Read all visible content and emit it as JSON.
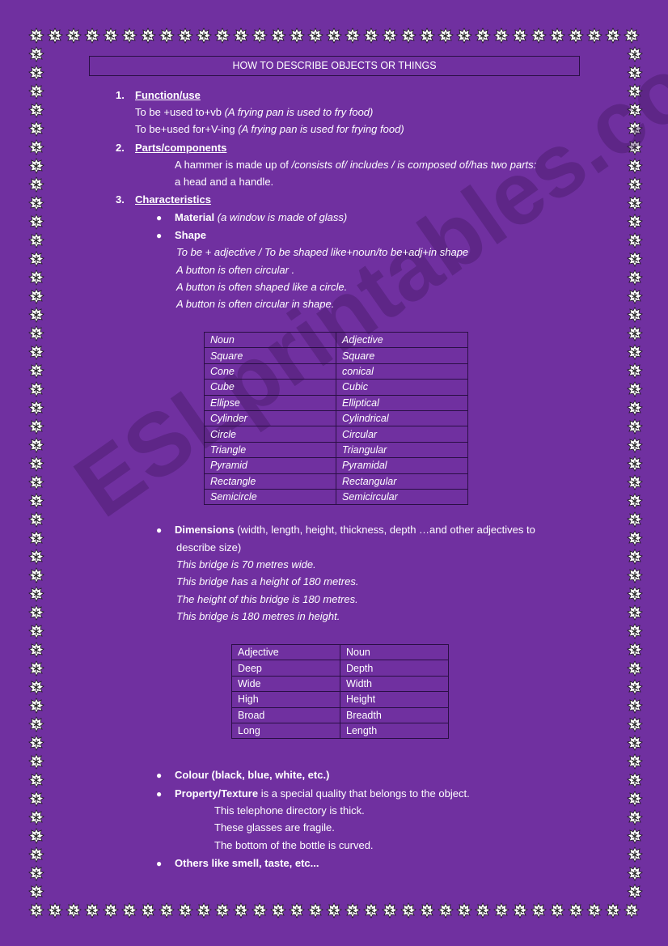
{
  "title": "HOW TO DESCRIBE OBJECTS OR THINGS",
  "colors": {
    "background": "#7030a0",
    "text": "#ffffff",
    "border_line": "#2a0f45"
  },
  "border_icon": "leaf-icon",
  "watermark": "ESLprintables.com",
  "sections": [
    {
      "number": "1.",
      "heading": "Function/use",
      "lines": [
        {
          "plain": "To be +used to+vb ",
          "italic": "(A frying pan  is used to fry food)"
        },
        {
          "plain": "To be+used for+V-ing ",
          "italic": "(A frying pan  is used for frying  food)"
        }
      ]
    },
    {
      "number": "2.",
      "heading": "Parts/components",
      "lines": [
        {
          "plain": "A hammer  is made up of ",
          "italic": "/consists of/ includes / is composed of/has two parts:"
        },
        {
          "plain": "a head and a handle.",
          "italic": ""
        }
      ]
    },
    {
      "number": "3.",
      "heading": "Characteristics",
      "material": {
        "label": "Material",
        "example": " (a window  is made of glass)"
      },
      "shape": {
        "label": "Shape",
        "lines": [
          "To be + adjective / To be shaped like+noun/to be+adj+in shape",
          "A button is often circular .",
          "A button  is often  shaped like a circle.",
          "A button  is often circular in shape."
        ],
        "table": {
          "headers": [
            "Noun",
            "Adjective"
          ],
          "rows": [
            [
              "Square",
              "Square"
            ],
            [
              "Cone",
              "conical"
            ],
            [
              "Cube",
              "Cubic"
            ],
            [
              "Ellipse",
              "Elliptical"
            ],
            [
              "Cylinder",
              "Cylindrical"
            ],
            [
              "Circle",
              "Circular"
            ],
            [
              "Triangle",
              "Triangular"
            ],
            [
              "Pyramid",
              "Pyramidal"
            ],
            [
              "Rectangle",
              "Rectangular"
            ],
            [
              "Semicircle",
              "Semicircular"
            ]
          ]
        }
      },
      "dimensions": {
        "label": "Dimensions",
        "desc_1": " (width, length, height, thickness, depth …and other adjectives to",
        "desc_2": "describe size)",
        "examples": [
          "This bridge  is 70 metres wide.",
          "This bridge  has a height of 180 metres.",
          "The height of this bridge  is 180 metres.",
          "This bridge   is 180 metres in height."
        ],
        "table": {
          "headers": [
            "Adjective",
            "Noun"
          ],
          "rows": [
            [
              "Deep",
              "Depth"
            ],
            [
              "Wide",
              "Width"
            ],
            [
              "High",
              "Height"
            ],
            [
              "Broad",
              "Breadth"
            ],
            [
              "Long",
              "Length"
            ]
          ]
        }
      },
      "colour": {
        "label": "Colour (black, blue, white, etc.)"
      },
      "property": {
        "label": "Property/Texture",
        "desc": " is a special quality that belongs to the object.",
        "examples": [
          "This telephone directory  is thick.",
          "These  glasses  are  fragile.",
          "The bottom   of the bottle is curved."
        ]
      },
      "others": {
        "label": "Others like smell, taste, etc..."
      }
    }
  ]
}
